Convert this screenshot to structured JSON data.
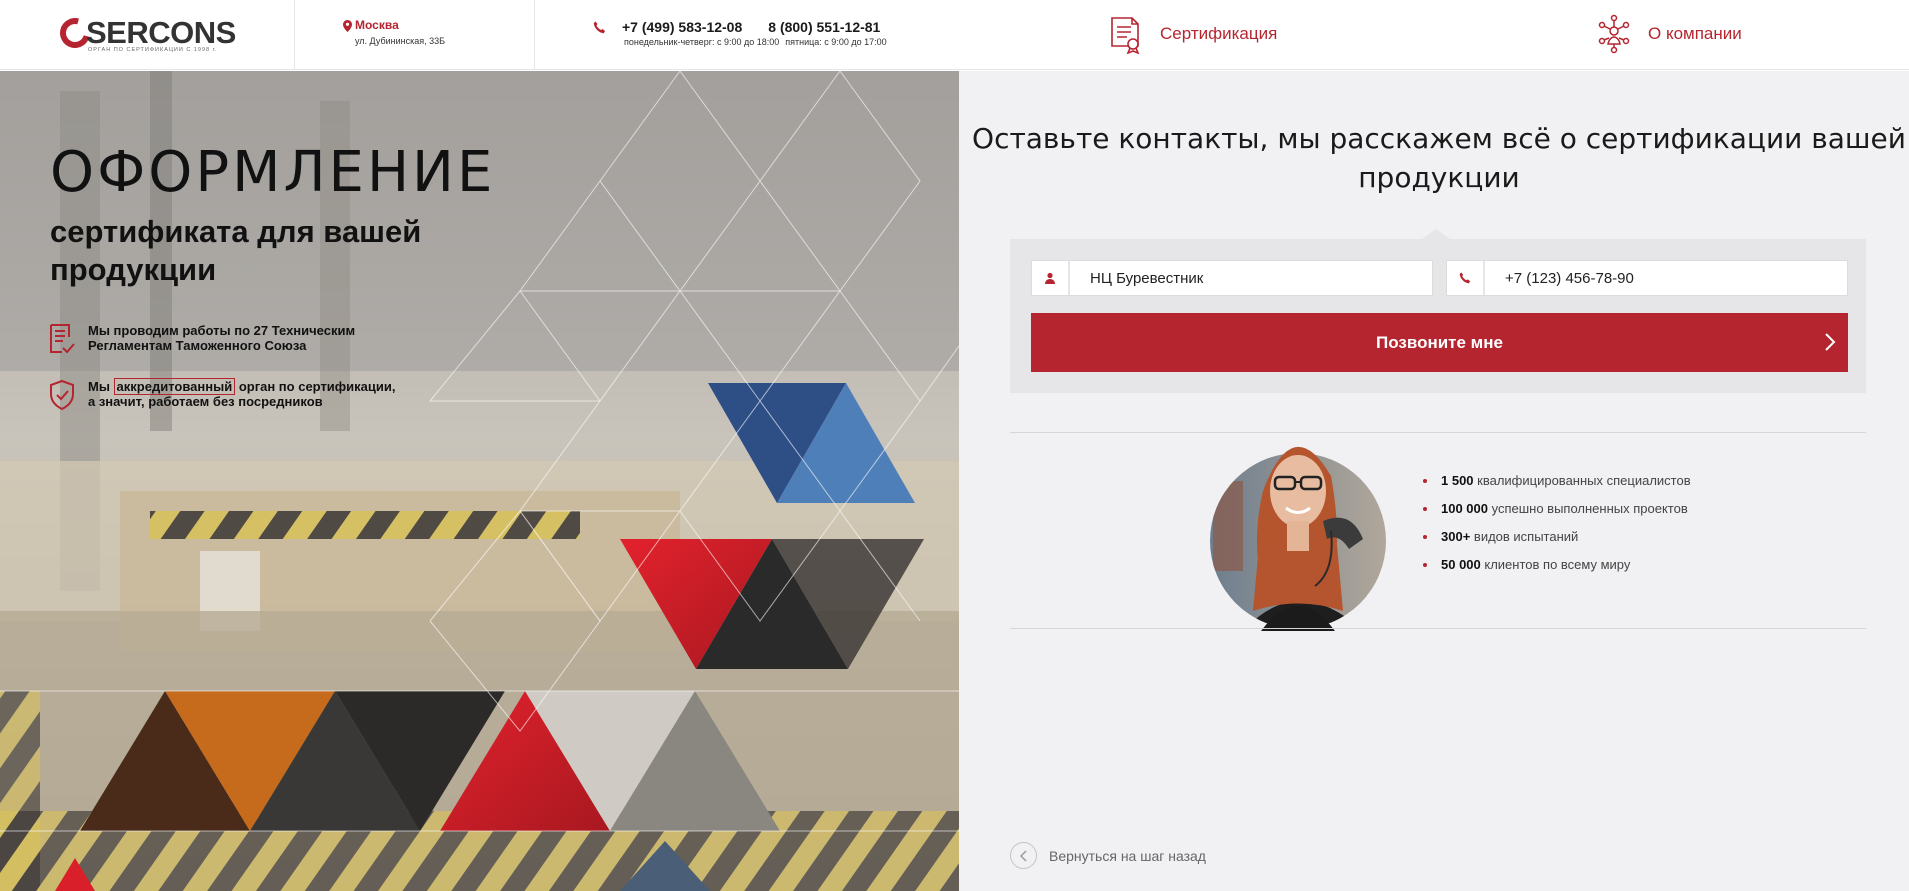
{
  "header": {
    "logo_text": "SERCONS",
    "logo_sub": "ОРГАН ПО СЕРТИФИКАЦИИ С 1998 г.",
    "city": "Москва",
    "address": "ул. Дубининская, 33Б",
    "phone1": "+7 (499) 583-12-08",
    "phone2": "8 (800) 551-12-81",
    "hours1": "понедельник-четверг: с 9:00 до 18:00",
    "hours2": "пятница: с 9:00 до 17:00",
    "nav": [
      {
        "label": "Сертификация",
        "icon": "certificate-icon"
      },
      {
        "label": "О компании",
        "icon": "team-network-icon"
      }
    ],
    "accent": "#b52530"
  },
  "hero": {
    "title": "ОФОРМЛЕНИЕ",
    "subtitle": "сертификата для вашей продукции",
    "feature1": "Мы проводим работы по 27 Техническим Регламентам Таможенного Союза",
    "feature2_pre": "Мы ",
    "feature2_highlight": "аккредитованный",
    "feature2_post": " орган по сертификации, а значит, работаем без посредников"
  },
  "form": {
    "heading": "Оставьте контакты, мы расскажем всё о сертификации вашей продукции",
    "name_value": "НЦ Буревестник",
    "phone_value": "+7 (123) 456-78-90",
    "submit_label": "Позвоните мне"
  },
  "stats": [
    {
      "num": "1 500",
      "text": " квалифицированных специалистов"
    },
    {
      "num": "100 000",
      "text": " успешно выполненных проектов"
    },
    {
      "num": "300+",
      "text": " видов испытаний"
    },
    {
      "num": "50 000",
      "text": " клиентов по всему миру"
    }
  ],
  "back_label": "Вернуться на шаг назад"
}
